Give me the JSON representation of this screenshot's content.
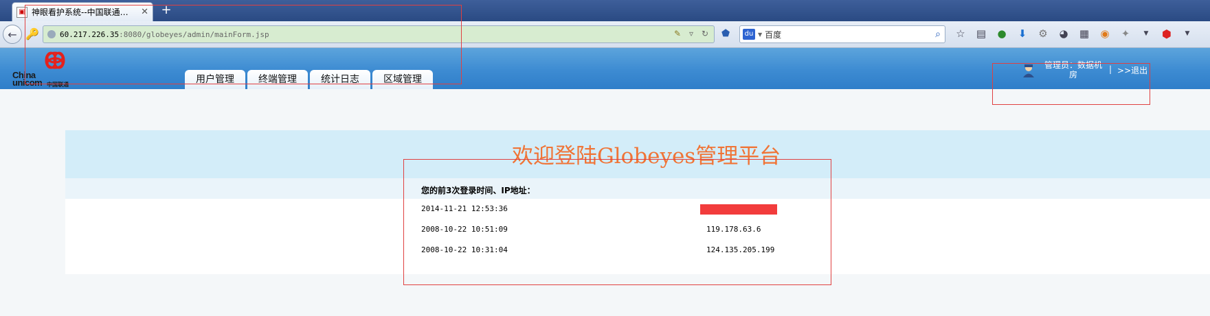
{
  "browser": {
    "tab_title": "神眼看护系统--中国联通…",
    "tab_favicon": "page-icon",
    "new_tab_label": "+",
    "url_host": "60.217.226.35",
    "url_path": ":8080/globeyes/admin/mainForm.jsp",
    "search_placeholder": "百度"
  },
  "site": {
    "logo_en": "China\nunicom",
    "logo_cn": "中国联通",
    "nav_tabs": [
      "用户管理",
      "终端管理",
      "统计日志",
      "区域管理"
    ],
    "user_label": "管理员：数据机房",
    "separator": "|",
    "logout_label": ">>退出"
  },
  "main": {
    "welcome_title": "欢迎登陆Globeyes管理平台",
    "info_heading": "您的前3次登录时间、IP地址：",
    "logins": [
      {
        "time": "2014-11-21 12:53:36",
        "ip": ""
      },
      {
        "time": "2008-10-22 10:51:09",
        "ip": "119.178.63.6"
      },
      {
        "time": "2008-10-22 10:31:04",
        "ip": "124.135.205.199"
      }
    ]
  },
  "colors": {
    "header_blue": "#3d8bd2",
    "welcome_orange": "#f07436",
    "redaction_red": "#f23c3c",
    "annotation_red": "#e04040"
  }
}
